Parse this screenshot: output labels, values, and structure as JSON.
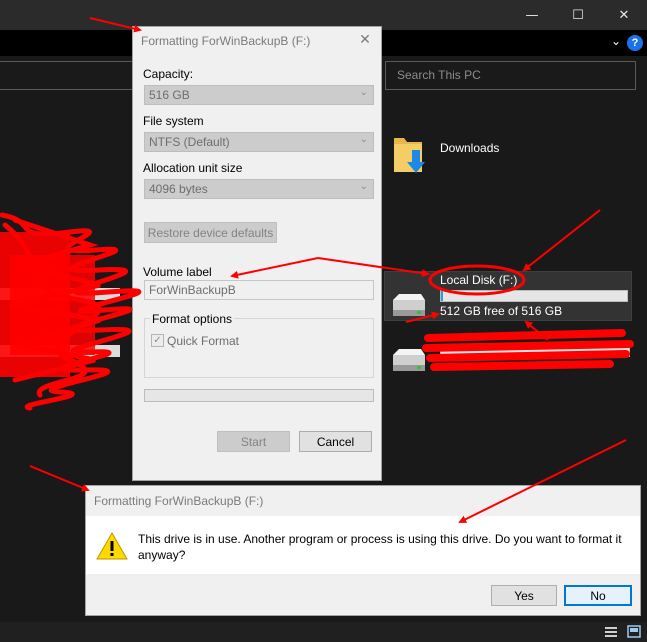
{
  "explorer": {
    "minimize_glyph": "—",
    "maximize_glyph": "☐",
    "close_glyph": "✕",
    "ribbon_expand_glyph": "⌄",
    "help_glyph": "?",
    "search_placeholder": "Search This PC",
    "folder": {
      "label": "Downloads",
      "icon": "downloads-folder-icon"
    },
    "drive": {
      "name": "Local Disk (F:)",
      "free_text": "512 GB free of 516 GB",
      "used_fraction": 0.01,
      "icon": "hard-drive-icon"
    },
    "second_drive_icon": "hard-drive-icon"
  },
  "format_dialog": {
    "title": "Formatting ForWinBackupB (F:)",
    "close_glyph": "✕",
    "capacity_label": "Capacity:",
    "capacity_value": "516 GB",
    "filesystem_label": "File system",
    "filesystem_value": "NTFS (Default)",
    "allocation_label": "Allocation unit size",
    "allocation_value": "4096 bytes",
    "restore_button": "Restore device defaults",
    "volume_label": "Volume label",
    "volume_value": "ForWinBackupB",
    "format_options_label": "Format options",
    "quick_format_label": "Quick Format",
    "quick_format_checked": true,
    "progress": 0,
    "start_button": "Start",
    "cancel_button": "Cancel"
  },
  "confirm_dialog": {
    "title": "Formatting ForWinBackupB (F:)",
    "message": "This drive is in use. Another program or process is using this drive. Do you want to format it anyway?",
    "yes_button": "Yes",
    "no_button": "No",
    "icon": "warning-icon"
  },
  "colors": {
    "annotation_red": "#ff0000",
    "accent_blue": "#0078d7",
    "drive_bar_blue": "#26a0da"
  }
}
